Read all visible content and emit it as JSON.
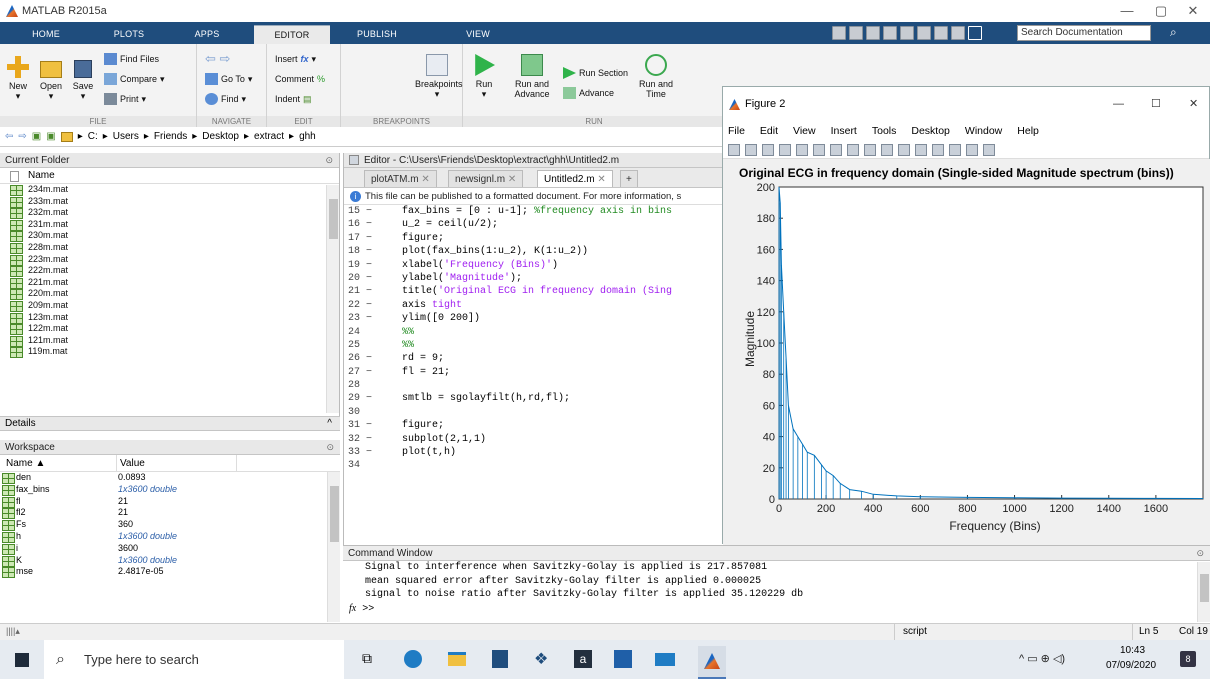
{
  "app_title": "MATLAB R2015a",
  "tabs": [
    "HOME",
    "PLOTS",
    "APPS",
    "EDITOR",
    "PUBLISH",
    "VIEW"
  ],
  "active_tab": "EDITOR",
  "search_placeholder": "Search Documentation",
  "ribbon": {
    "file": {
      "new": "New",
      "open": "Open",
      "save": "Save",
      "find_files": "Find Files",
      "compare": "Compare",
      "print": "Print",
      "label": "FILE"
    },
    "navigate": {
      "goto": "Go To",
      "find": "Find",
      "label": "NAVIGATE"
    },
    "edit": {
      "insert": "Insert",
      "comment": "Comment",
      "indent": "Indent",
      "label": "EDIT"
    },
    "breakpoints": {
      "breakpoints": "Breakpoints",
      "label": "BREAKPOINTS"
    },
    "run": {
      "run": "Run",
      "run_advance": "Run and Advance",
      "run_section": "Run Section",
      "advance": "Advance",
      "run_time": "Run and Time",
      "label": "RUN"
    }
  },
  "address": [
    "C:",
    "Users",
    "Friends",
    "Desktop",
    "extract",
    "ghh"
  ],
  "current_folder": {
    "title": "Current Folder",
    "col_name": "Name",
    "files": [
      "234m.mat",
      "233m.mat",
      "232m.mat",
      "231m.mat",
      "230m.mat",
      "228m.mat",
      "223m.mat",
      "222m.mat",
      "221m.mat",
      "220m.mat",
      "209m.mat",
      "123m.mat",
      "122m.mat",
      "121m.mat",
      "119m.mat"
    ]
  },
  "details_label": "Details",
  "workspace": {
    "title": "Workspace",
    "col_name": "Name ▲",
    "col_value": "Value",
    "vars": [
      {
        "name": "den",
        "value": "0.0893",
        "it": false
      },
      {
        "name": "fax_bins",
        "value": "1x3600 double",
        "it": true
      },
      {
        "name": "fl",
        "value": "21",
        "it": false
      },
      {
        "name": "fl2",
        "value": "21",
        "it": false
      },
      {
        "name": "Fs",
        "value": "360",
        "it": false
      },
      {
        "name": "h",
        "value": "1x3600 double",
        "it": true
      },
      {
        "name": "i",
        "value": "3600",
        "it": false
      },
      {
        "name": "K",
        "value": "1x3600 double",
        "it": true
      },
      {
        "name": "mse",
        "value": "2.4817e-05",
        "it": false
      }
    ]
  },
  "editor": {
    "path": "Editor - C:\\Users\\Friends\\Desktop\\extract\\ghh\\Untitled2.m",
    "tabs": [
      "plotATM.m",
      "newsignl.m",
      "Untitled2.m"
    ],
    "info": "This file can be published to a formatted document. For more information, s",
    "lines": [
      {
        "n": "15 −",
        "html": "fax_bins = [0 : u-1]; <span class=\"c\">%frequency axis in bins</span>"
      },
      {
        "n": "16 −",
        "html": "u_2 = ceil(u/2);"
      },
      {
        "n": "17 −",
        "html": "figure;"
      },
      {
        "n": "18 −",
        "html": "plot(fax_bins(1:u_2), K(1:u_2))"
      },
      {
        "n": "19 −",
        "html": "xlabel(<span class=\"s\">'Frequency (Bins)'</span>)"
      },
      {
        "n": "20 −",
        "html": "ylabel(<span class=\"s\">'Magnitude'</span>);"
      },
      {
        "n": "21 −",
        "html": "title(<span class=\"s\">'Original ECG in frequency domain (Sing</span>"
      },
      {
        "n": "22 −",
        "html": "axis <span class=\"s\">tight</span>"
      },
      {
        "n": "23 −",
        "html": "ylim([0 200])"
      },
      {
        "n": "24",
        "html": "<span class=\"c\">%%</span>"
      },
      {
        "n": "25",
        "html": "<span class=\"c\">%%</span>"
      },
      {
        "n": "26 −",
        "html": "rd = 9;"
      },
      {
        "n": "27 −",
        "html": "fl = 21;"
      },
      {
        "n": "28",
        "html": ""
      },
      {
        "n": "29 −",
        "html": "smtlb = sgolayfilt(h,rd,fl);"
      },
      {
        "n": "30",
        "html": ""
      },
      {
        "n": "31 −",
        "html": "figure;"
      },
      {
        "n": "32 −",
        "html": "subplot(2,1,1)"
      },
      {
        "n": "33 −",
        "html": "plot(t,h)"
      },
      {
        "n": "34",
        "html": ""
      }
    ]
  },
  "command_window": {
    "title": "Command Window",
    "lines": [
      "Signal to interference when Savitzky-Golay is applied is 217.857081",
      "mean squared error after Savitzky-Golay filter is applied 0.000025",
      "signal to noise ratio after Savitzky-Golay filter is applied 35.120229 db"
    ],
    "prompt": ">>"
  },
  "status": {
    "mode": "script",
    "ln": "Ln 5",
    "col": "Col 19"
  },
  "taskbar": {
    "search": "Type here to search",
    "time": "10:43",
    "date": "07/09/2020",
    "notif": "8"
  },
  "figure": {
    "title": "Figure 2",
    "menu": [
      "File",
      "Edit",
      "View",
      "Insert",
      "Tools",
      "Desktop",
      "Window",
      "Help"
    ]
  },
  "chart_data": {
    "type": "line",
    "title": "Original ECG in frequency domain (Single-sided Magnitude spectrum (bins))",
    "xlabel": "Frequency (Bins)",
    "ylabel": "Magnitude",
    "xlim": [
      0,
      1800
    ],
    "ylim": [
      0,
      200
    ],
    "xticks": [
      0,
      200,
      400,
      600,
      800,
      1000,
      1200,
      1400,
      1600
    ],
    "yticks": [
      0,
      20,
      40,
      60,
      80,
      100,
      120,
      140,
      160,
      180,
      200
    ],
    "color": "#0072bd",
    "series": [
      {
        "x": [
          0,
          5,
          10,
          20,
          30,
          40,
          60,
          80,
          100,
          120,
          150,
          180,
          200,
          230,
          260,
          300,
          350,
          400,
          500,
          600,
          800,
          1000,
          1200,
          1400,
          1600,
          1800
        ],
        "y": [
          200,
          190,
          150,
          120,
          90,
          60,
          45,
          40,
          35,
          30,
          28,
          22,
          18,
          15,
          10,
          6,
          5,
          3,
          2,
          1.5,
          1,
          0.8,
          0.6,
          0.5,
          0.4,
          0.3
        ]
      }
    ]
  }
}
